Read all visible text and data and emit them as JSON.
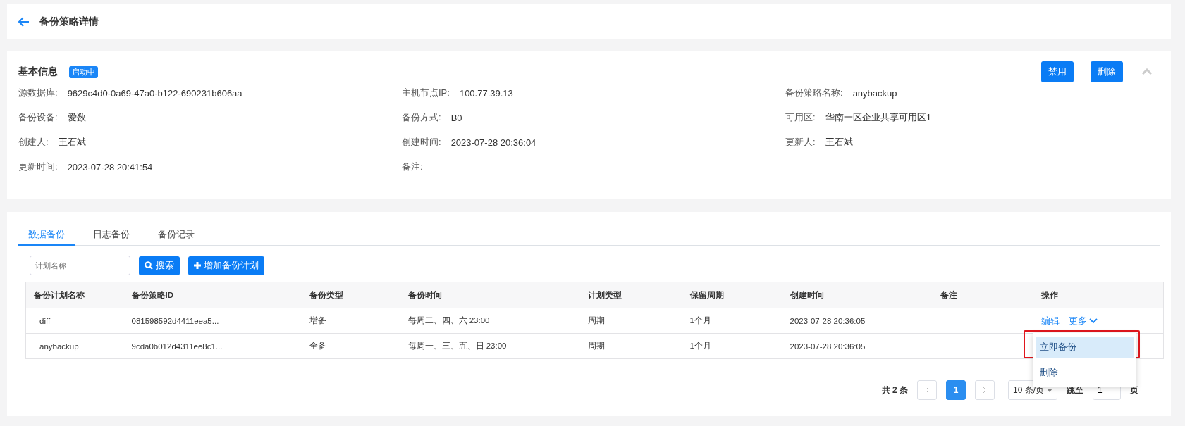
{
  "header": {
    "title": "备份策略详情"
  },
  "info": {
    "title": "基本信息",
    "status": "启动中",
    "actions": [
      "禁用",
      "删除"
    ],
    "collapsed": false,
    "fields": [
      {
        "label": "源数据库:",
        "value": "9629c4d0-0a69-47a0-b122-690231b606aa"
      },
      {
        "label": "主机节点IP:",
        "value": "100.77.39.13"
      },
      {
        "label": "备份策略名称:",
        "value": "anybackup"
      },
      {
        "label": "备份设备:",
        "value": "爱数"
      },
      {
        "label": "备份方式:",
        "value": "B0"
      },
      {
        "label": "可用区:",
        "value": "华南一区企业共享可用区1"
      },
      {
        "label": "创建人:",
        "value": "王石斌"
      },
      {
        "label": "创建时间:",
        "value": "2023-07-28 20:36:04"
      },
      {
        "label": "更新人:",
        "value": "王石斌"
      },
      {
        "label": "更新时间:",
        "value": "2023-07-28 20:41:54"
      },
      {
        "label": "备注:"
      }
    ]
  },
  "tabs": [
    {
      "label": "数据备份",
      "selected": true
    },
    {
      "label": "日志备份",
      "selected": false
    },
    {
      "label": "备份记录",
      "selected": false
    }
  ],
  "toolbar": {
    "search_placeholder": "计划名称",
    "search_button": "搜索",
    "add_button": "增加备份计划"
  },
  "table": {
    "columns": [
      "备份计划名称",
      "备份策略ID",
      "备份类型",
      "备份时间",
      "计划类型",
      "保留周期",
      "创建时间",
      "备注",
      "操作"
    ],
    "rows": [
      {
        "cells": [
          "diff",
          "081598592d4411eea5...",
          "增备",
          "每周二、四、六 23:00",
          "周期",
          "1个月",
          "2023-07-28 20:36:05"
        ],
        "actions": [
          "编辑",
          "更多"
        ]
      },
      {
        "cells": [
          "anybackup",
          "9cda0b012d4311ee8c1...",
          "全备",
          "每周一、三、五、日 23:00",
          "周期",
          "1个月",
          "2023-07-28 20:36:05"
        ]
      }
    ]
  },
  "dropdown": [
    {
      "label": "立即备份",
      "selected": true,
      "outlined": true
    },
    {
      "label": "删除",
      "selected": false,
      "outlined": false
    }
  ],
  "pagination": {
    "total": "共 2 条",
    "pages": [
      {
        "label": "1",
        "selected": true
      }
    ],
    "page_size": "10 条/页",
    "jump_label": "跳至",
    "jump_value": "1",
    "page_unit": "页"
  }
}
